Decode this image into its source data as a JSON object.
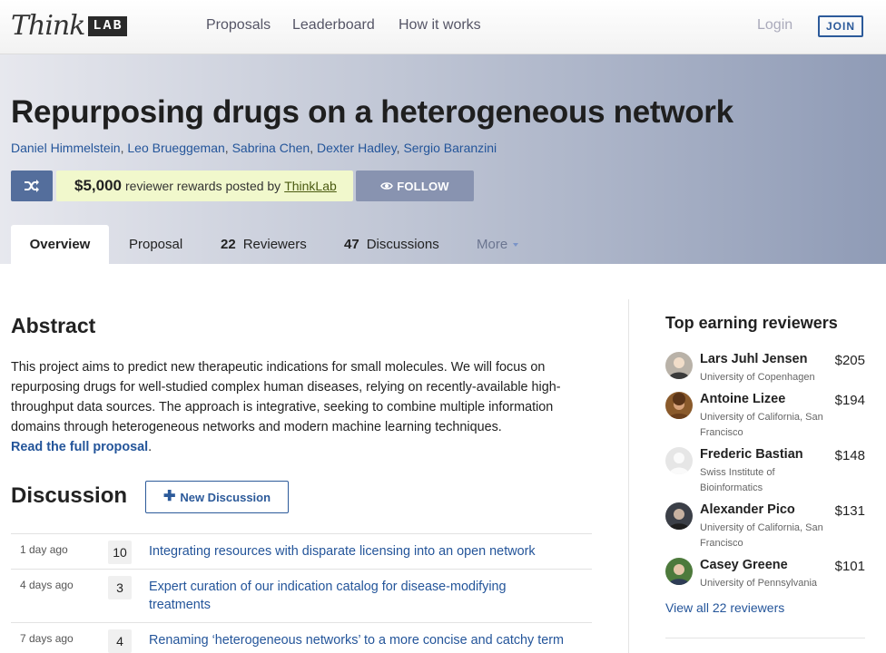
{
  "nav": {
    "logo_script": "Think",
    "logo_lab": "LAB",
    "links": [
      "Proposals",
      "Leaderboard",
      "How it works"
    ],
    "login": "Login",
    "join": "JOIN"
  },
  "hero": {
    "title": "Repurposing drugs on a heterogeneous network",
    "authors": [
      "Daniel Himmelstein",
      "Leo Brueggeman",
      "Sabrina Chen",
      "Dexter Hadley",
      "Sergio Baranzini"
    ],
    "author_separator": ", ",
    "reward_amount": "$5,000",
    "reward_text": "reviewer rewards posted by",
    "reward_link": "ThinkLab",
    "follow": "FOLLOW",
    "icons": {
      "shuffle": "shuffle-icon",
      "follow": "eye-icon"
    },
    "colors": {
      "shuffle_bg": "#546e9c",
      "reward_bg": "#f1f8cc",
      "follow_bg": "#8893b0"
    }
  },
  "tabs": [
    {
      "count": "",
      "label": "Overview"
    },
    {
      "count": "",
      "label": "Proposal"
    },
    {
      "count": "22",
      "label": "Reviewers"
    },
    {
      "count": "47",
      "label": "Discussions"
    },
    {
      "count": "",
      "label": "More"
    }
  ],
  "abstract": {
    "heading": "Abstract",
    "text": "This project aims to predict new therapeutic indications for small molecules. We will focus on repurposing drugs for well-studied complex human diseases, relying on recently-available high-throughput data sources. The approach is integrative, seeking to combine multiple information domains through heterogeneous networks and modern machine learning techniques.",
    "read_link": "Read the full proposal",
    "read_suffix": "."
  },
  "discussion": {
    "heading": "Discussion",
    "new_button": "New Discussion",
    "items": [
      {
        "age": "1 day ago",
        "count": "10",
        "title": "Integrating resources with disparate licensing into an open network"
      },
      {
        "age": "4 days ago",
        "count": "3",
        "title": "Expert curation of our indication catalog for disease-modifying treatments"
      },
      {
        "age": "7 days ago",
        "count": "4",
        "title": "Renaming ‘heterogeneous networks’ to a more concise and catchy term"
      }
    ]
  },
  "sidebar": {
    "title": "Top earning reviewers",
    "reviewers": [
      {
        "name": "Lars Juhl Jensen",
        "affiliation": "University of Copenhagen",
        "amount": "$205"
      },
      {
        "name": "Antoine Lizee",
        "affiliation": "University of California, San Francisco",
        "amount": "$194"
      },
      {
        "name": "Frederic Bastian",
        "affiliation": "Swiss Institute of Bioinformatics",
        "amount": "$148"
      },
      {
        "name": "Alexander Pico",
        "affiliation": "University of California, San Francisco",
        "amount": "$131"
      },
      {
        "name": "Casey Greene",
        "affiliation": "University of Pennsylvania",
        "amount": "$101"
      }
    ],
    "view_all": "View all 22 reviewers"
  }
}
